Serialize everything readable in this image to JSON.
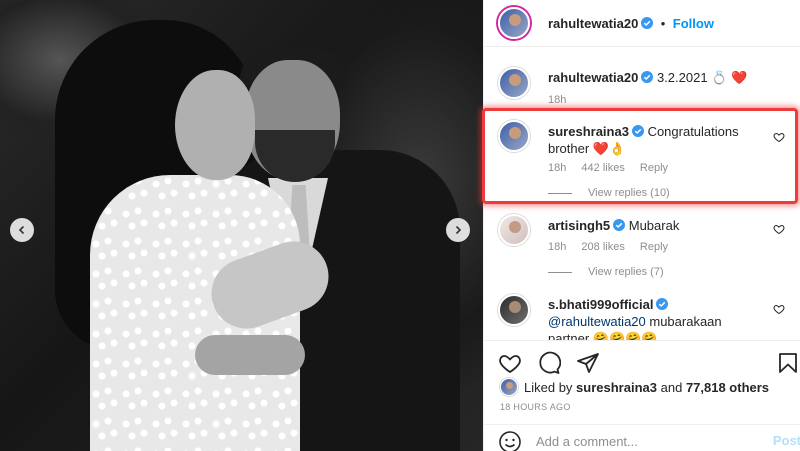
{
  "post": {
    "author": "rahultewatia20",
    "follow_label": "Follow",
    "dot": "•"
  },
  "caption": {
    "username": "rahultewatia20",
    "text": "3.2.2021 💍 ❤️",
    "age": "18h"
  },
  "comments": [
    {
      "username": "sureshraina3",
      "text": "Congratulations brother ❤️👌",
      "age": "18h",
      "likes": "442 likes",
      "reply_label": "Reply",
      "view_replies": "View replies (10)"
    },
    {
      "username": "artisingh5",
      "text": "Mubarak",
      "age": "18h",
      "likes": "208 likes",
      "reply_label": "Reply",
      "view_replies": "View replies (7)"
    },
    {
      "username": "s.bhati999official",
      "mention": "@rahultewatia20",
      "text": " mubarakaan partner 🤗🤗🤗🤗"
    }
  ],
  "likes": {
    "prefix": "Liked by ",
    "user": "sureshraina3",
    "middle": " and ",
    "count": "77,818 others"
  },
  "timestamp": "18 HOURS AGO",
  "add_comment": {
    "placeholder": "Add a comment...",
    "post_label": "Post"
  },
  "colors": {
    "accent": "#0095f6",
    "highlight": "#ef3b3b",
    "verified": "#3897f0"
  }
}
